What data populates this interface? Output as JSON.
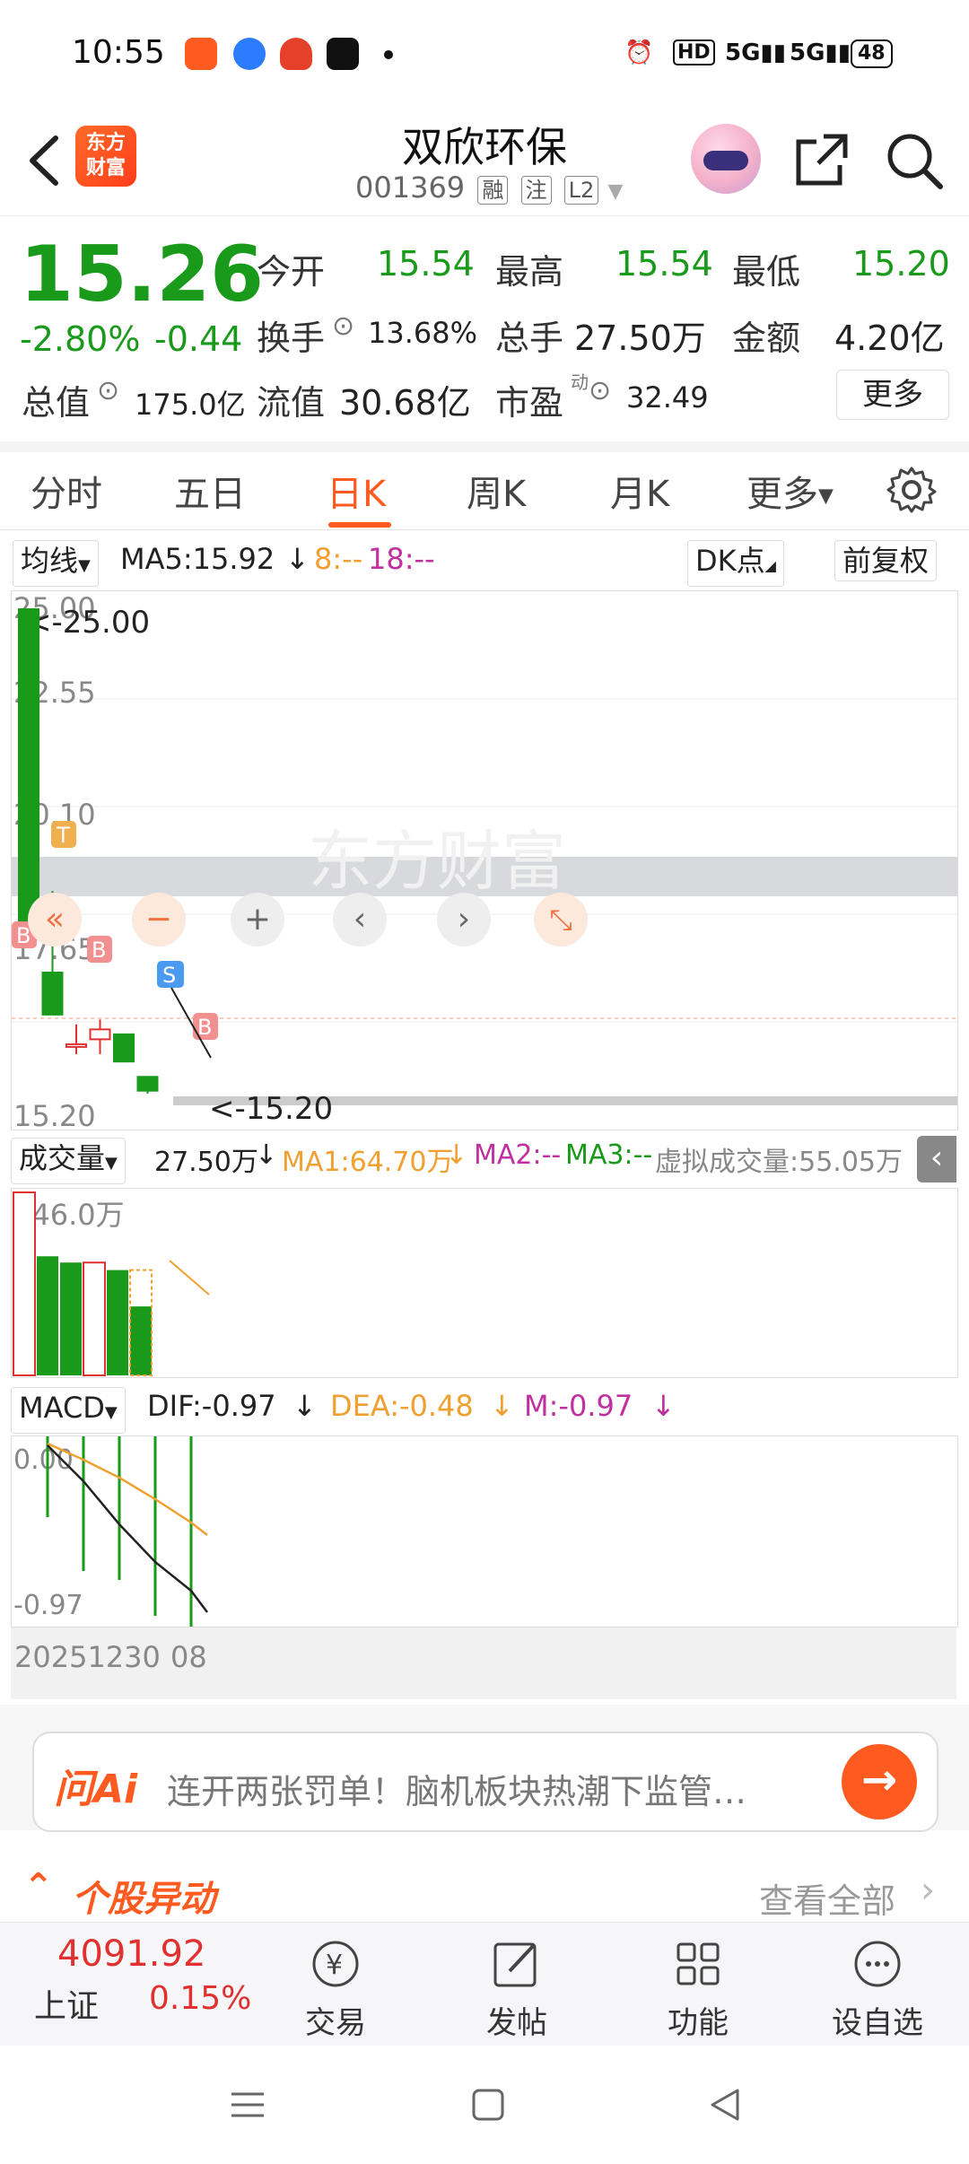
{
  "status_bar": {
    "time": "10:55",
    "battery": "48",
    "icons": [
      "orange-app-icon",
      "blue-app-icon",
      "red-app-icon",
      "tiktok-icon",
      "alarm-icon",
      "hd-icon",
      "5g-signal-icon",
      "5g-signal-icon",
      "battery-icon"
    ]
  },
  "header": {
    "logo_line1": "东方",
    "logo_line2": "财富",
    "title": "双欣环保",
    "code": "001369",
    "tags": [
      "融",
      "注",
      "L2"
    ]
  },
  "quote": {
    "price": "15.26",
    "change_pct": "-2.80%",
    "change": "-0.44",
    "open_label": "今开",
    "open": "15.54",
    "high_label": "最高",
    "high": "15.54",
    "low_label": "最低",
    "low": "15.20",
    "turnover_label": "换手",
    "turnover": "13.68%",
    "volume_label": "总手",
    "volume": "27.50万",
    "amount_label": "金额",
    "amount": "4.20亿",
    "mcap_label": "总值",
    "mcap": "175.0亿",
    "float_label": "流值",
    "float": "30.68亿",
    "pe_label": "市盈",
    "pe_sup": "动",
    "pe": "32.49",
    "more": "更多"
  },
  "tabs": [
    "分时",
    "五日",
    "日K",
    "周K",
    "月K",
    "更多"
  ],
  "active_tab": "日K",
  "ma_bar": {
    "mode": "均线",
    "ma5": "MA5:15.92",
    "ma8": "8:--",
    "ma18": "18:--",
    "dk": "DK点",
    "adjust": "前复权"
  },
  "kline": {
    "watermark": "东方财富",
    "y_labels": [
      "25.00",
      "22.55",
      "20.10",
      "17.65",
      "15.20"
    ],
    "max_label": "<-25.00",
    "min_label": "<-15.20",
    "markers": [
      "B",
      "T",
      "B",
      "S",
      "B"
    ],
    "colors": {
      "up": "#e03030",
      "down": "#1a9a1a",
      "ma": "#f0a030"
    }
  },
  "chart_data": {
    "type": "candlestick",
    "ylim": [
      15.2,
      25.0
    ],
    "candles": [
      {
        "open": 25.0,
        "high": 25.0,
        "low": 18.5,
        "close": 18.5
      },
      {
        "open": 17.65,
        "high": 19.3,
        "low": 16.8,
        "close": 16.8
      },
      {
        "open": 16.2,
        "high": 16.6,
        "low": 16.0,
        "close": 16.2
      },
      {
        "open": 16.3,
        "high": 16.7,
        "low": 16.0,
        "close": 16.5
      },
      {
        "open": 16.4,
        "high": 16.4,
        "low": 15.9,
        "close": 15.85
      },
      {
        "open": 15.54,
        "high": 15.54,
        "low": 15.2,
        "close": 15.26
      }
    ],
    "volume": {
      "label": "成交量",
      "value": "27.50万",
      "max_label": "146.0万",
      "ma1": "MA1:64.70万",
      "ma2": "MA2:--",
      "ma3": "MA3:--",
      "virtual": "虚拟成交量:55.05万"
    },
    "macd": {
      "label": "MACD",
      "dif": "DIF:-0.97",
      "dea": "DEA:-0.48",
      "m": "M:-0.97",
      "y_top": "0.00",
      "y_bottom": "-0.97"
    },
    "x_labels": [
      "20251230",
      "08"
    ]
  },
  "ask_ai": {
    "logo": "问Ai",
    "text": "连开两张罚单！脑机板块热潮下监管…"
  },
  "moves": {
    "title": "个股异动",
    "link": "查看全部"
  },
  "bottom_nav": {
    "index_value": "4091.92",
    "index_name": "上证",
    "index_change": "0.15%",
    "items": [
      "交易",
      "发帖",
      "功能",
      "设自选"
    ]
  }
}
